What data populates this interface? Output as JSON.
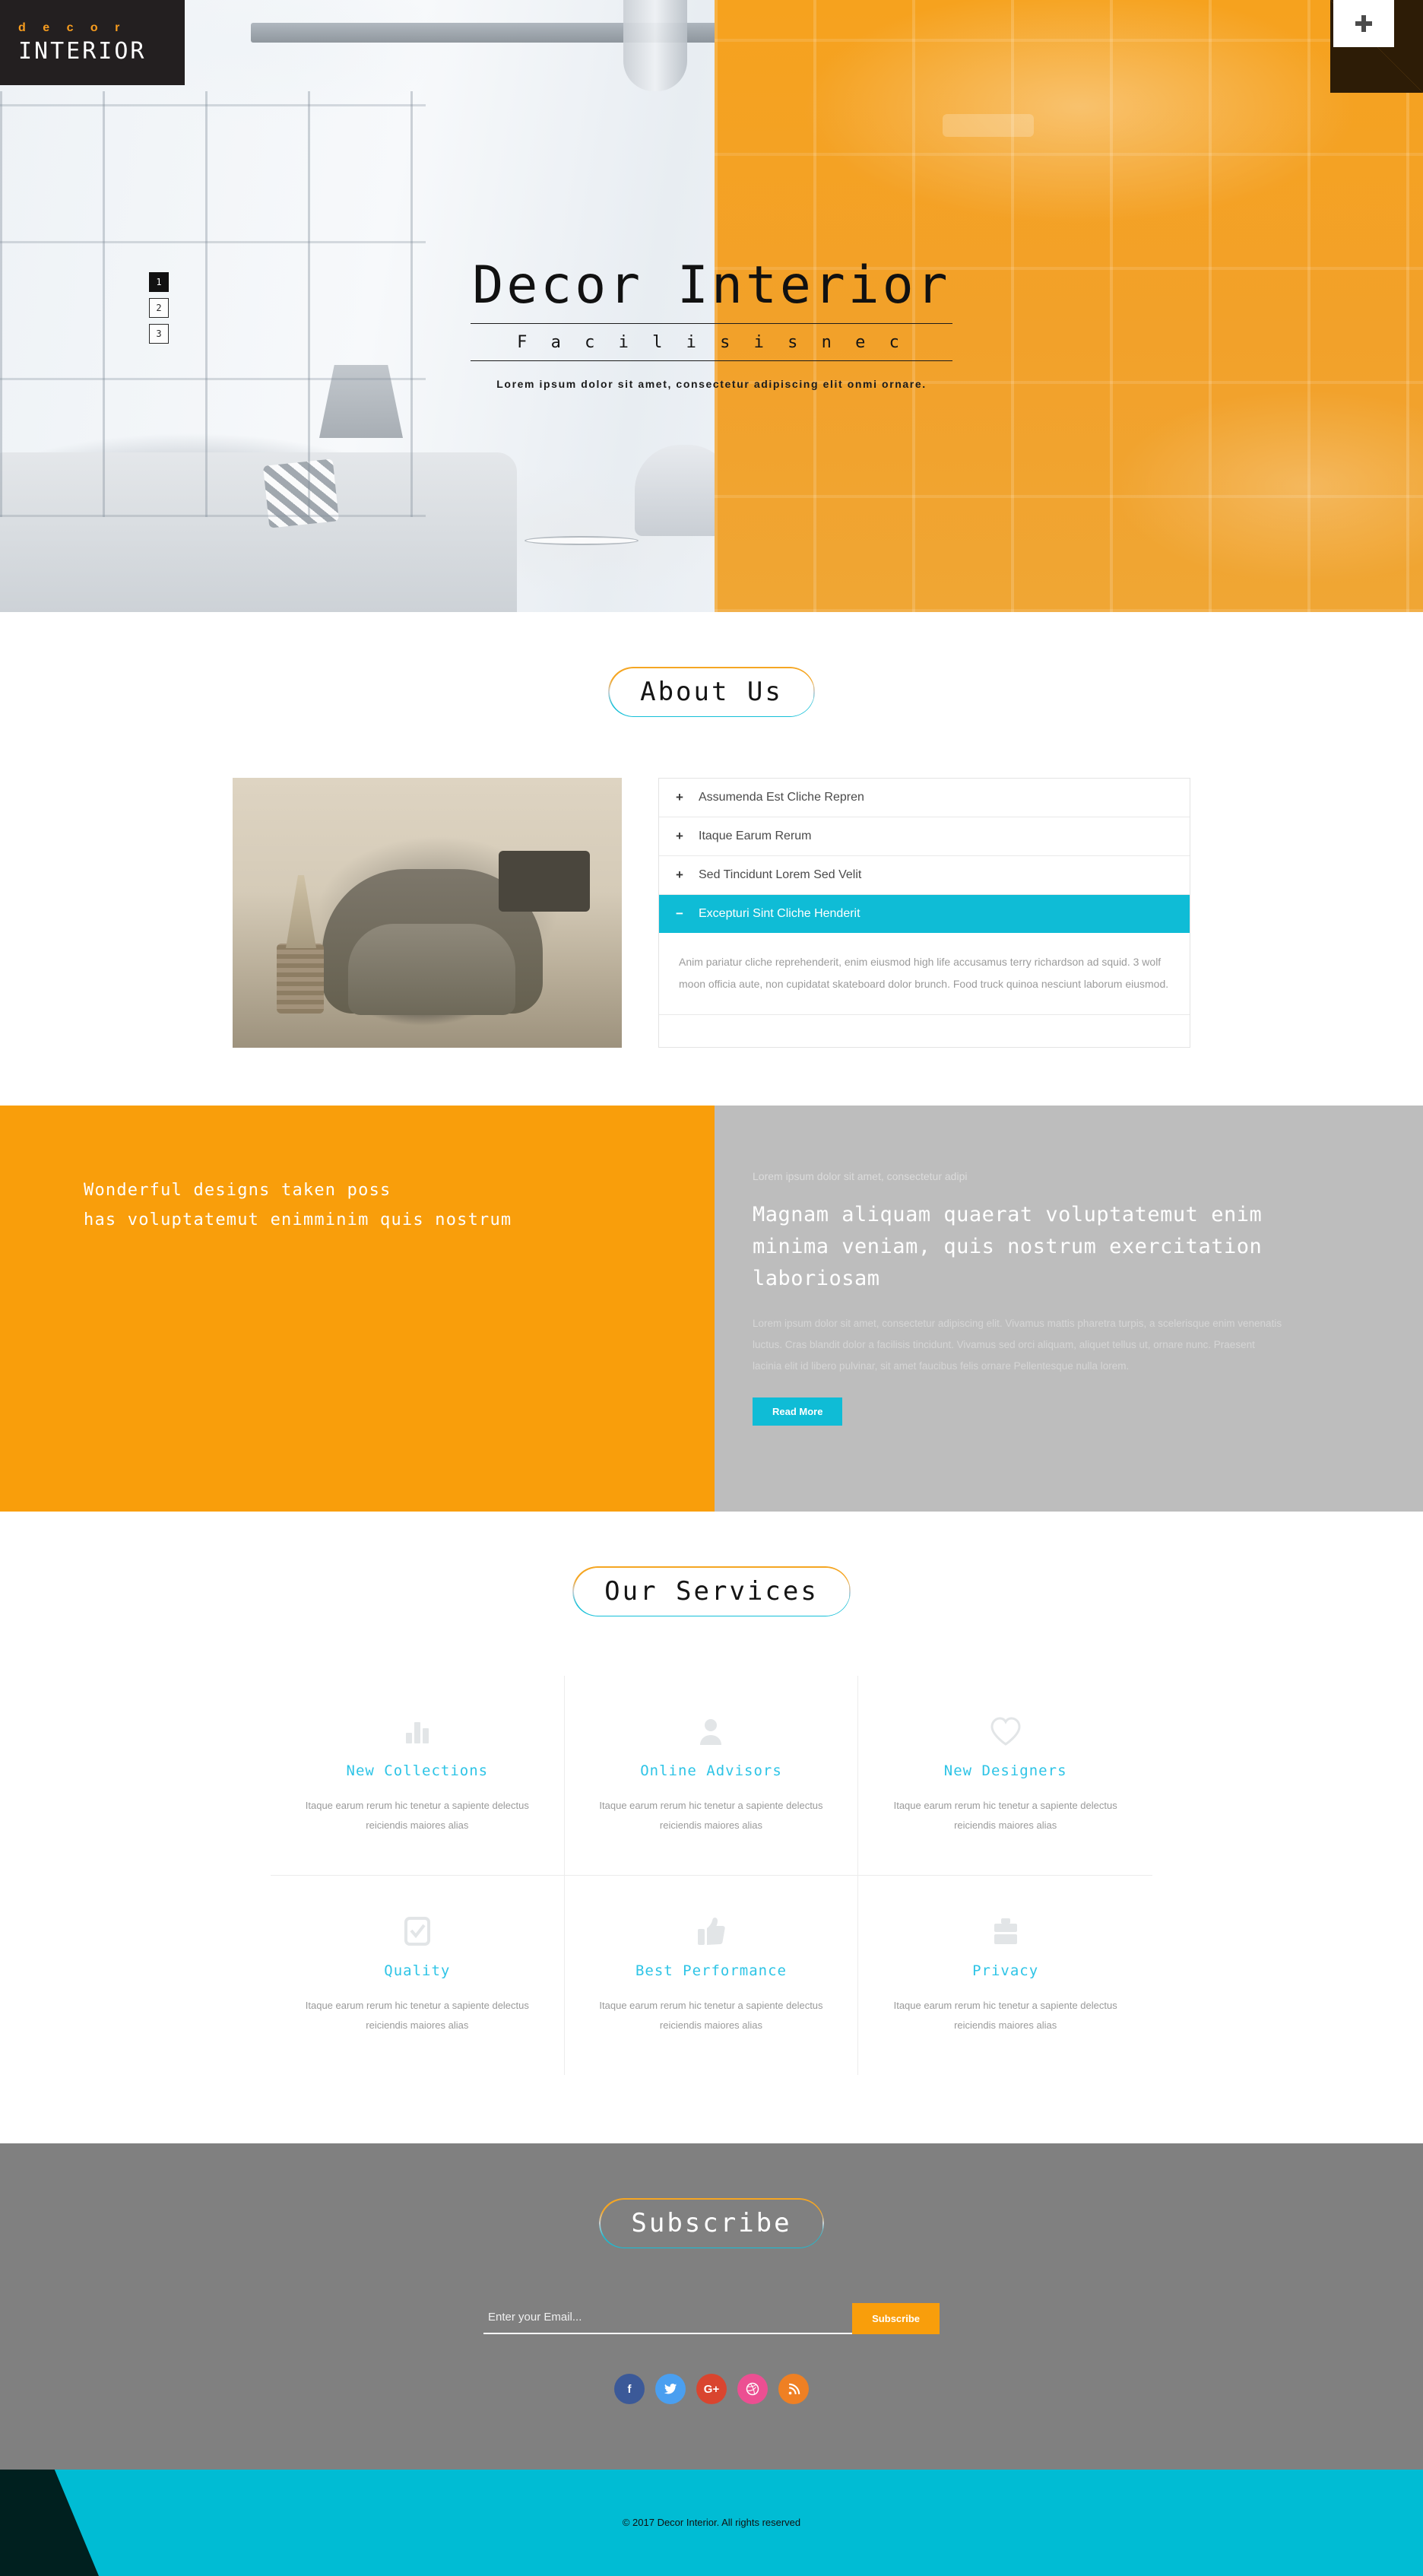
{
  "brand": {
    "top": "d e c o r",
    "bottom": "INTERIOR"
  },
  "header": {
    "menu_icon": "plus-icon"
  },
  "hero": {
    "title": "Decor Interior",
    "subtitle": "F a c i l i s i s   n e c",
    "description": "Lorem ipsum dolor sit amet, consectetur adipiscing elit onmi ornare.",
    "slides": [
      "1",
      "2",
      "3"
    ],
    "active_slide": "1"
  },
  "about": {
    "heading": "About Us",
    "accordion": [
      {
        "label": "Assumenda Est Cliche Repren",
        "sign": "+",
        "open": false
      },
      {
        "label": "Itaque Earum Rerum",
        "sign": "+",
        "open": false
      },
      {
        "label": "Sed Tincidunt Lorem Sed Velit",
        "sign": "+",
        "open": false
      },
      {
        "label": "Excepturi Sint Cliche Henderit",
        "sign": "−",
        "open": true
      }
    ],
    "open_body": "Anim pariatur cliche reprehenderit, enim eiusmod high life accusamus terry richardson ad squid. 3 wolf moon officia aute, non cupidatat skateboard dolor brunch. Food truck quinoa nesciunt laborum eiusmod."
  },
  "promo": {
    "left_line1": "Wonderful designs taken poss",
    "left_line2": "has voluptatemut enimminim quis nostrum",
    "eyebrow": "Lorem ipsum dolor sit amet, consectetur adipi",
    "title": "Magnam aliquam quaerat voluptatemut enim minima veniam, quis nostrum exercitation laboriosam",
    "body": "Lorem ipsum dolor sit amet, consectetur adipiscing elit. Vivamus mattis pharetra turpis, a scelerisque enim venenatis luctus. Cras blandit dolor a facilisis tincidunt. Vivamus sed orci aliquam, aliquet tellus ut, ornare nunc. Praesent lacinia elit id libero pulvinar, sit amet faucibus felis ornare Pellentesque nulla lorem.",
    "button": "Read More"
  },
  "services": {
    "heading": "Our Services",
    "cards": [
      {
        "icon": "bar-chart-icon",
        "title": "New Collections",
        "desc": "Itaque earum rerum hic tenetur a sapiente delectus reiciendis maiores alias"
      },
      {
        "icon": "user-icon",
        "title": "Online Advisors",
        "desc": "Itaque earum rerum hic tenetur a sapiente delectus reiciendis maiores alias"
      },
      {
        "icon": "heart-icon",
        "title": "New Designers",
        "desc": "Itaque earum rerum hic tenetur a sapiente delectus reiciendis maiores alias"
      },
      {
        "icon": "check-box-icon",
        "title": "Quality",
        "desc": "Itaque earum rerum hic tenetur a sapiente delectus reiciendis maiores alias"
      },
      {
        "icon": "thumbs-up-icon",
        "title": "Best Performance",
        "desc": "Itaque earum rerum hic tenetur a sapiente delectus reiciendis maiores alias"
      },
      {
        "icon": "briefcase-icon",
        "title": "Privacy",
        "desc": "Itaque earum rerum hic tenetur a sapiente delectus reiciendis maiores alias"
      }
    ]
  },
  "subscribe": {
    "heading": "Subscribe",
    "email_placeholder": "Enter your Email...",
    "email_value": "",
    "button": "Subscribe",
    "socials": [
      {
        "name": "facebook",
        "glyph": "f",
        "color": "#3b5998"
      },
      {
        "name": "twitter",
        "glyph": "",
        "color": "#4a9ff0"
      },
      {
        "name": "google-plus",
        "glyph": "G+",
        "color": "#d9452f"
      },
      {
        "name": "dribbble",
        "glyph": "",
        "color": "#ec4f92"
      },
      {
        "name": "rss",
        "glyph": "",
        "color": "#ef8023"
      }
    ]
  },
  "footer": {
    "copyright": "© 2017 Decor Interior. All rights reserved"
  },
  "colors": {
    "orange": "#f99e0b",
    "cyan": "#0fbcd6",
    "gray": "#808080",
    "dark": "#231f20"
  }
}
